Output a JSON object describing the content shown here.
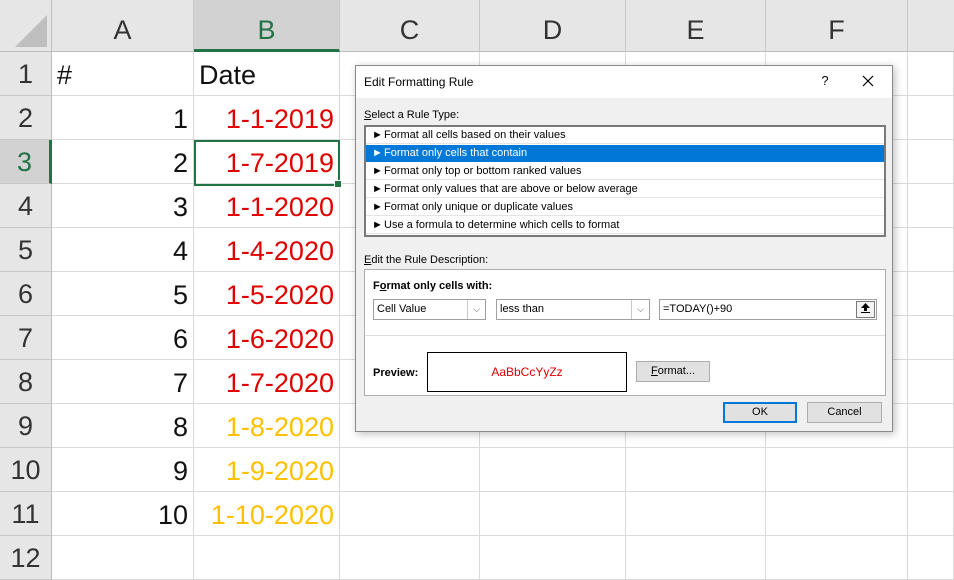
{
  "sheet": {
    "columns": [
      "A",
      "B",
      "C",
      "D",
      "E",
      "F"
    ],
    "active_column": "B",
    "rows": [
      "1",
      "2",
      "3",
      "4",
      "5",
      "6",
      "7",
      "8",
      "9",
      "10",
      "11",
      "12"
    ],
    "active_row": "3",
    "header": {
      "a": "#",
      "b": "Date"
    },
    "data": [
      {
        "num": "1",
        "date": "1-1-2019",
        "color": "#e00000"
      },
      {
        "num": "2",
        "date": "1-7-2019",
        "color": "#e00000"
      },
      {
        "num": "3",
        "date": "1-1-2020",
        "color": "#e00000"
      },
      {
        "num": "4",
        "date": "1-4-2020",
        "color": "#e00000"
      },
      {
        "num": "5",
        "date": "1-5-2020",
        "color": "#e00000"
      },
      {
        "num": "6",
        "date": "1-6-2020",
        "color": "#e00000"
      },
      {
        "num": "7",
        "date": "1-7-2020",
        "color": "#e00000"
      },
      {
        "num": "8",
        "date": "1-8-2020",
        "color": "#ffc000"
      },
      {
        "num": "9",
        "date": "1-9-2020",
        "color": "#ffc000"
      },
      {
        "num": "10",
        "date": "1-10-2020",
        "color": "#ffc000"
      }
    ]
  },
  "dialog": {
    "title": "Edit Formatting Rule",
    "help": "?",
    "select_rule_type": {
      "accel": "S",
      "rest": "elect a Rule Type:"
    },
    "rule_types": [
      "Format all cells based on their values",
      "Format only cells that contain",
      "Format only top or bottom ranked values",
      "Format only values that are above or below average",
      "Format only unique or duplicate values",
      "Use a formula to determine which cells to format"
    ],
    "selected_rule_index": 1,
    "rule_arrow": "►",
    "edit_desc": {
      "accel": "E",
      "rest": "dit the Rule Description:"
    },
    "format_only_with": {
      "accel": "o",
      "pre": "F",
      "rest": "rmat only cells with:"
    },
    "condition_field": "Cell Value",
    "operator": "less than",
    "formula": "=TODAY()+90",
    "preview_label": "Preview:",
    "preview_sample": "AaBbCcYyZz",
    "preview_color": "#e00000",
    "format_button": {
      "accel": "F",
      "rest": "ormat..."
    },
    "ok": "OK",
    "cancel": "Cancel"
  }
}
